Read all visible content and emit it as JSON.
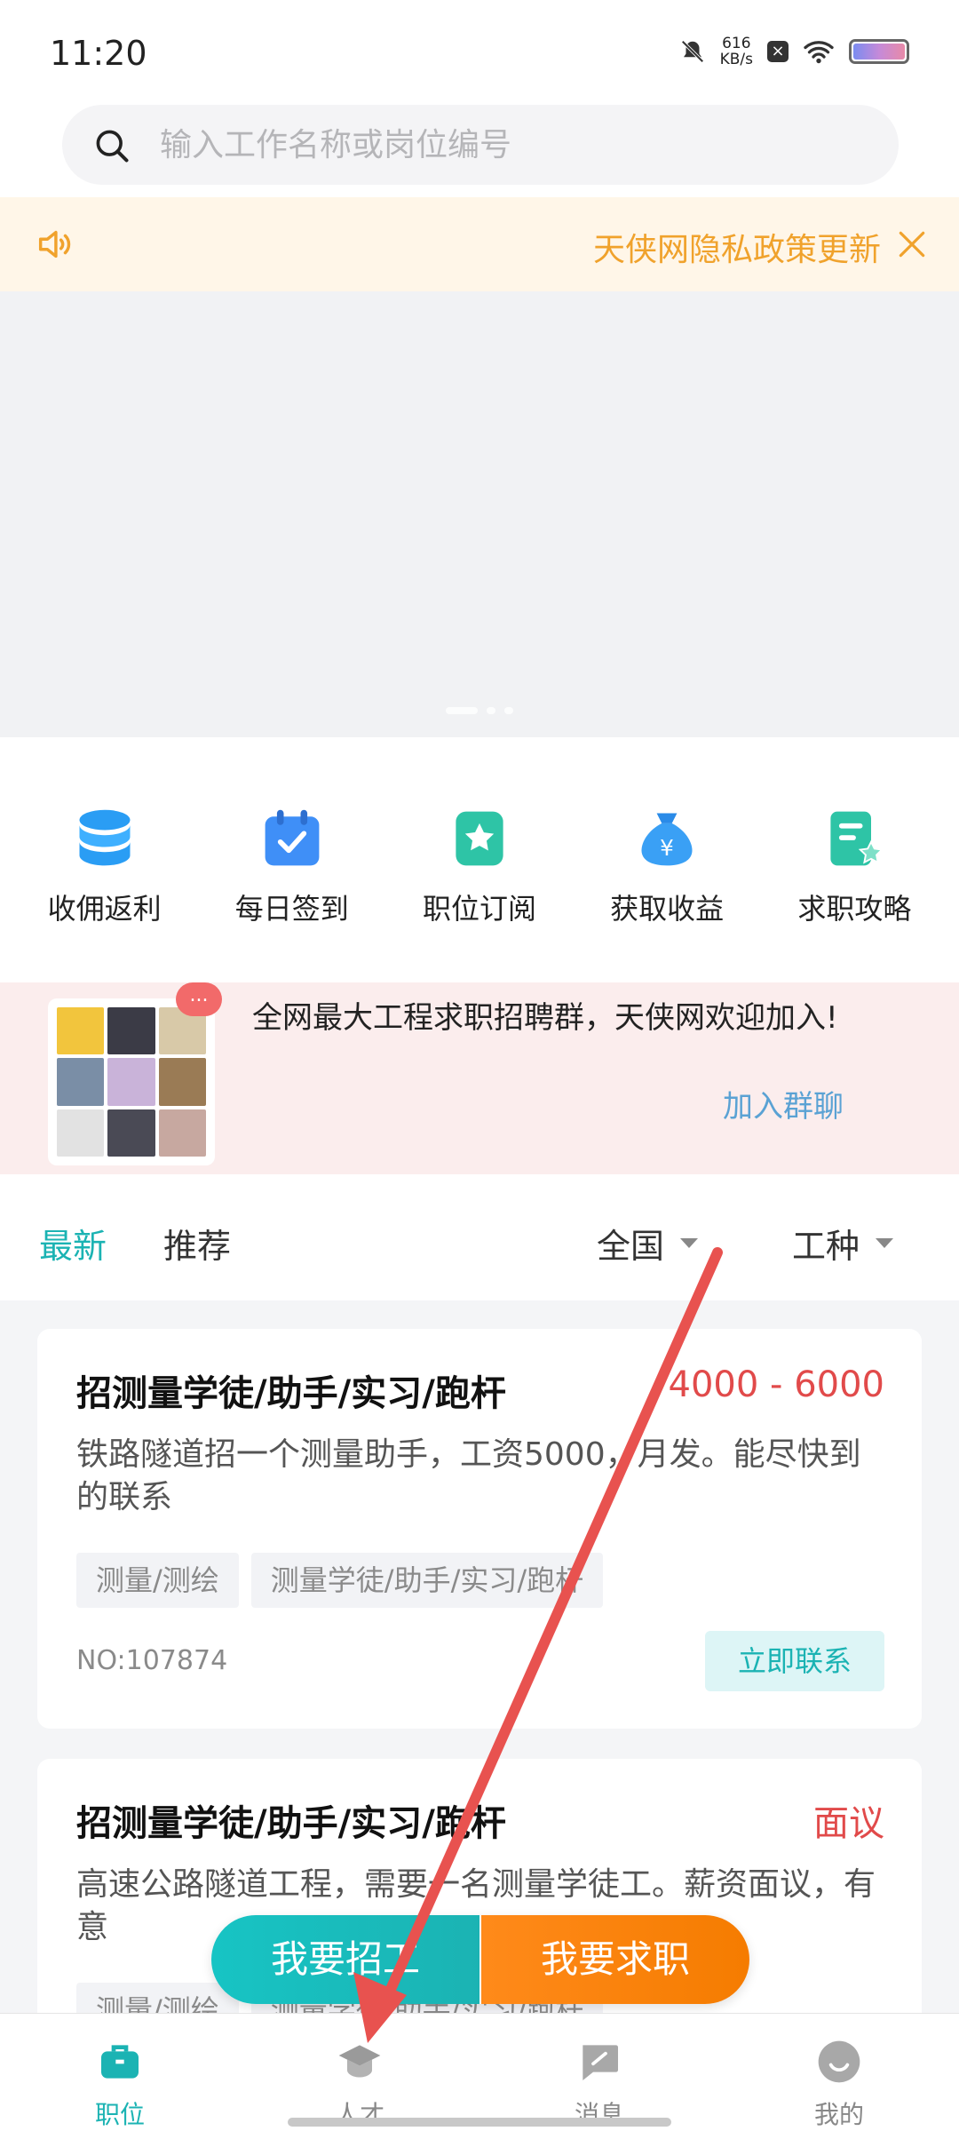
{
  "status": {
    "time": "11:20",
    "net_speed_value": "616",
    "net_speed_unit": "KB/s"
  },
  "search": {
    "placeholder": "输入工作名称或岗位编号"
  },
  "notice": {
    "text": "天侠网隐私政策更新"
  },
  "shortcuts": [
    {
      "label": "收佣返利",
      "icon": "database-icon"
    },
    {
      "label": "每日签到",
      "icon": "calendar-check-icon"
    },
    {
      "label": "职位订阅",
      "icon": "star-badge-icon"
    },
    {
      "label": "获取收益",
      "icon": "money-bag-icon"
    },
    {
      "label": "求职攻略",
      "icon": "document-star-icon"
    }
  ],
  "group": {
    "badge": "...",
    "text": "全网最大工程求职招聘群，天侠网欢迎加入!",
    "join_label": "加入群聊"
  },
  "filter": {
    "tabs": [
      "最新",
      "推荐"
    ],
    "region": "全国",
    "trade": "工种"
  },
  "jobs": [
    {
      "title": "招测量学徒/助手/实习/跑杆",
      "salary": "4000 - 6000",
      "desc": "铁路隧道招一个测量助手，工资5000，月发。能尽快到的联系",
      "tags": [
        "测量/测绘",
        "测量学徒/助手/实习/跑杆"
      ],
      "no": "NO:107874",
      "contact_label": "立即联系"
    },
    {
      "title": "招测量学徒/助手/实习/跑杆",
      "salary": "面议",
      "desc": "高速公路隧道工程，需要一名测量学徒工。薪资面议，有意",
      "tags": [
        "测量/测绘",
        "测量学徒/助手/实习/跑杆"
      ]
    }
  ],
  "float_buttons": {
    "hire": "我要招工",
    "seek": "我要求职"
  },
  "tabbar": [
    {
      "label": "职位",
      "icon": "briefcase-icon",
      "active": true
    },
    {
      "label": "人才",
      "icon": "graduation-cap-icon",
      "active": false
    },
    {
      "label": "消息",
      "icon": "message-icon",
      "active": false
    },
    {
      "label": "我的",
      "icon": "profile-face-icon",
      "active": false
    }
  ],
  "colors": {
    "accent": "#1bb3b3",
    "salary": "#e14a4a",
    "notice": "#f0a22c",
    "seek": "#f57c00",
    "annotation_arrow": "#e8524f"
  }
}
